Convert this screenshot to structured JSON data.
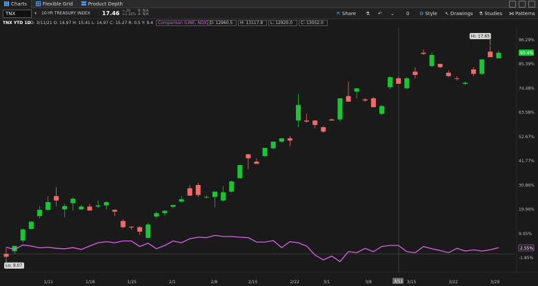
{
  "tabs": [
    {
      "label": "Charts",
      "icon": "chart-icon",
      "active": true
    },
    {
      "label": "Flexible Grid",
      "icon": "grid-icon"
    },
    {
      "label": "Product Depth",
      "icon": "depth-icon"
    }
  ],
  "toolbar": {
    "symbol": "TNX",
    "name": "10-YR TREASURY INDEX",
    "last": "17.46",
    "change": "+.20",
    "change_pct": "+1.16%",
    "bid": "B: N/A",
    "ask": "A: N/A",
    "share": "Share",
    "style": "Style",
    "drawings": "Drawings",
    "studies": "Studies",
    "patterns": "Patterns",
    "zero": "0"
  },
  "studybar": {
    "title": "TNX YTD 1D",
    "ohlc": "D: 3/11/21  O: 14.97  H: 15.41  L: 14.97  C: 15.27  R: 0.5  Y: 9.4",
    "comparison": "Comparison (LINE, NDX)",
    "c1": "O: 12960.5",
    "c2": "H: 13117.8",
    "c3": "L: 12920.0",
    "c4": "C: 13052.0"
  },
  "chart_data": {
    "type": "candlestick",
    "y_labels": [
      "96.29%",
      "85.39%",
      "74.48%",
      "63.58%",
      "52.67%",
      "41.77%",
      "30.86%",
      "19.96%",
      "9.05%",
      "-1.85%"
    ],
    "x_labels": [
      "1/11",
      "1/18",
      "1/25",
      "2/1",
      "2/8",
      "2/15",
      "2/22",
      "3/1",
      "3/8",
      "3/15",
      "3/22",
      "3/29"
    ],
    "crosshair_label": "3/11",
    "hi_label": "Hi: 17.65",
    "lo_label": "Lo: 9.07",
    "last_pct": "90.4%",
    "comp_pct": "2.55%",
    "candles": [
      {
        "o": 0.0,
        "h": 2.8,
        "l": -2.0,
        "c": -1.3
      },
      {
        "o": 1.2,
        "h": 3.0,
        "l": 0.0,
        "c": 3.6
      },
      {
        "o": 6.0,
        "h": 11.5,
        "l": 5.0,
        "c": 11.0
      },
      {
        "o": 11.2,
        "h": 14.5,
        "l": 11.0,
        "c": 14.5
      },
      {
        "o": 17.0,
        "h": 21.5,
        "l": 16.0,
        "c": 19.8
      },
      {
        "o": 19.8,
        "h": 26.0,
        "l": 19.5,
        "c": 23.3
      },
      {
        "o": 26.0,
        "h": 30.0,
        "l": 21.5,
        "c": 24.0
      },
      {
        "o": 20.0,
        "h": 22.5,
        "l": 16.5,
        "c": 21.5
      },
      {
        "o": 22.8,
        "h": 25.5,
        "l": 19.5,
        "c": 24.8
      },
      {
        "o": 20.0,
        "h": 22.0,
        "l": 19.8,
        "c": 21.3
      },
      {
        "o": 21.3,
        "h": 22.5,
        "l": 19.5,
        "c": 19.5
      },
      {
        "o": 21.3,
        "h": 24.0,
        "l": 20.5,
        "c": 21.8
      },
      {
        "o": 21.8,
        "h": 23.5,
        "l": 20.0,
        "c": 23.3
      },
      {
        "o": 19.8,
        "h": 20.0,
        "l": 17.0,
        "c": 19.0
      },
      {
        "o": 14.8,
        "h": 15.5,
        "l": 11.5,
        "c": 12.0
      },
      {
        "o": 12.2,
        "h": 12.5,
        "l": 11.0,
        "c": 12.0
      },
      {
        "o": 12.0,
        "h": 12.5,
        "l": 8.5,
        "c": 10.0
      },
      {
        "o": 7.2,
        "h": 14.0,
        "l": 6.8,
        "c": 13.2
      },
      {
        "o": 16.8,
        "h": 19.0,
        "l": 16.0,
        "c": 18.3
      },
      {
        "o": 18.3,
        "h": 19.5,
        "l": 17.0,
        "c": 19.4
      },
      {
        "o": 21.2,
        "h": 22.0,
        "l": 20.5,
        "c": 22.0
      },
      {
        "o": 23.5,
        "h": 26.0,
        "l": 23.0,
        "c": 24.6
      },
      {
        "o": 29.5,
        "h": 31.0,
        "l": 26.0,
        "c": 26.2
      },
      {
        "o": 31.0,
        "h": 32.0,
        "l": 25.5,
        "c": 26.5
      },
      {
        "o": 25.5,
        "h": 26.5,
        "l": 25.0,
        "c": 25.6
      },
      {
        "o": 25.6,
        "h": 27.0,
        "l": 21.0,
        "c": 28.0
      },
      {
        "o": 24.0,
        "h": 30.5,
        "l": 23.5,
        "c": 27.7
      },
      {
        "o": 28.0,
        "h": 33.0,
        "l": 27.5,
        "c": 32.6
      },
      {
        "o": 34.0,
        "h": 39.5,
        "l": 34.0,
        "c": 40.0
      },
      {
        "o": 44.8,
        "h": 45.0,
        "l": 38.0,
        "c": 43.0
      },
      {
        "o": 41.5,
        "h": 43.0,
        "l": 40.5,
        "c": 40.5
      },
      {
        "o": 44.0,
        "h": 47.0,
        "l": 43.5,
        "c": 47.7
      },
      {
        "o": 47.5,
        "h": 50.5,
        "l": 47.0,
        "c": 50.5
      },
      {
        "o": 50.5,
        "h": 51.5,
        "l": 50.0,
        "c": 52.0
      },
      {
        "o": 52.0,
        "h": 53.0,
        "l": 48.5,
        "c": 51.0
      },
      {
        "o": 60.0,
        "h": 72.0,
        "l": 57.0,
        "c": 67.0
      },
      {
        "o": 60.0,
        "h": 63.0,
        "l": 59.0,
        "c": 59.5
      },
      {
        "o": 60.0,
        "h": 60.0,
        "l": 56.5,
        "c": 58.0
      },
      {
        "o": 57.0,
        "h": 57.5,
        "l": 54.5,
        "c": 55.0
      },
      {
        "o": 60.5,
        "h": 61.0,
        "l": 60.0,
        "c": 60.0
      },
      {
        "o": 60.5,
        "h": 70.0,
        "l": 59.5,
        "c": 70.0
      },
      {
        "o": 71.0,
        "h": 77.5,
        "l": 68.5,
        "c": 68.5
      },
      {
        "o": 73.0,
        "h": 74.5,
        "l": 70.0,
        "c": 74.5
      },
      {
        "o": 69.5,
        "h": 70.0,
        "l": 68.5,
        "c": 69.0
      },
      {
        "o": 70.0,
        "h": 70.5,
        "l": 66.0,
        "c": 66.0
      },
      {
        "o": 63.0,
        "h": 67.0,
        "l": 62.5,
        "c": 66.5
      },
      {
        "o": 75.0,
        "h": 80.0,
        "l": 74.0,
        "c": 79.5
      },
      {
        "o": 79.0,
        "h": 79.8,
        "l": 76.5,
        "c": 76.5
      },
      {
        "o": 74.5,
        "h": 79.5,
        "l": 74.0,
        "c": 79.0
      },
      {
        "o": 82.0,
        "h": 84.0,
        "l": 79.0,
        "c": 80.5
      },
      {
        "o": 90.5,
        "h": 92.0,
        "l": 89.5,
        "c": 90.0
      },
      {
        "o": 84.5,
        "h": 90.5,
        "l": 84.0,
        "c": 89.5
      },
      {
        "o": 85.5,
        "h": 85.5,
        "l": 83.5,
        "c": 84.0
      },
      {
        "o": 81.5,
        "h": 82.5,
        "l": 79.5,
        "c": 80.0
      },
      {
        "o": 79.0,
        "h": 80.0,
        "l": 78.0,
        "c": 78.8
      },
      {
        "o": 76.5,
        "h": 77.5,
        "l": 76.0,
        "c": 77.0
      },
      {
        "o": 83.0,
        "h": 84.0,
        "l": 80.0,
        "c": 81.0
      },
      {
        "o": 81.0,
        "h": 87.0,
        "l": 80.5,
        "c": 87.5
      },
      {
        "o": 91.0,
        "h": 93.5,
        "l": 88.5,
        "c": 88.5
      },
      {
        "o": 88.0,
        "h": 91.5,
        "l": 88.0,
        "c": 90.5
      }
    ],
    "comparison_pct": [
      3.0,
      2.0,
      4.0,
      3.5,
      2.7,
      3.0,
      2.5,
      2.3,
      2.8,
      2.0,
      3.5,
      5.0,
      5.5,
      5.0,
      5.8,
      5.8,
      3.3,
      4.8,
      2.3,
      3.8,
      5.8,
      5.0,
      6.8,
      7.5,
      7.3,
      8.3,
      7.8,
      7.8,
      7.5,
      7.3,
      5.3,
      5.3,
      6.0,
      2.8,
      5.5,
      5.0,
      3.5,
      -0.5,
      -2.7,
      -1.0,
      -3.5,
      1.0,
      0.5,
      2.5,
      1.0,
      3.3,
      3.8,
      3.8,
      1.0,
      0.5,
      3.3,
      2.3,
      1.5,
      0.5,
      2.5,
      1.3,
      1.8,
      1.3,
      1.8,
      2.8
    ]
  }
}
